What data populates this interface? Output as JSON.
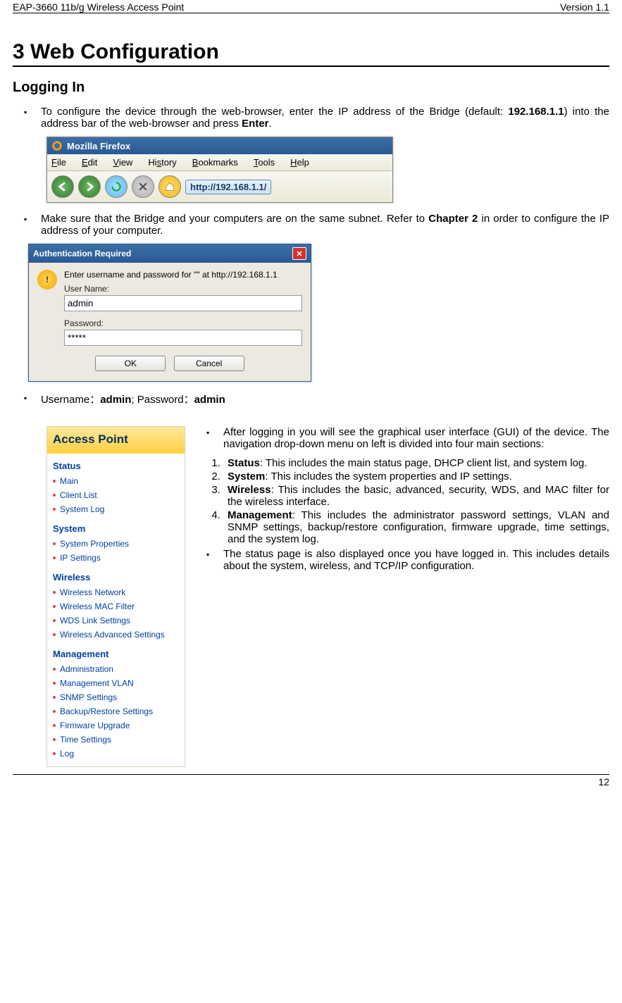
{
  "header": {
    "left": "EAP-3660  11b/g Wireless Access Point",
    "right": "Version 1.1"
  },
  "chapter": "3  Web Configuration",
  "section": "Logging In",
  "bullet1": {
    "pre": "To configure the device through the web-browser, enter the IP address of the Bridge (default: ",
    "ip": "192.168.1.1",
    "post1": ") into the address bar of the web-browser and press ",
    "enter": "Enter",
    "post2": "."
  },
  "firefox": {
    "title": "Mozilla Firefox",
    "menu": {
      "file": "File",
      "edit": "Edit",
      "view": "View",
      "history": "History",
      "bookmarks": "Bookmarks",
      "tools": "Tools",
      "help": "Help"
    },
    "url": "http://192.168.1.1/"
  },
  "bullet2": {
    "pre": "Make sure that the Bridge and your computers are on the same subnet. Refer to ",
    "chap": "Chapter 2",
    "post": " in order to configure the IP address of your computer."
  },
  "auth": {
    "title": "Authentication Required",
    "prompt": "Enter username and password for \"\" at http://192.168.1.1",
    "user_label": "User Name:",
    "user_value": "admin",
    "pass_label": "Password:",
    "pass_value": "*****",
    "ok": "OK",
    "cancel": "Cancel"
  },
  "bullet3": {
    "pre": "Username：",
    "u": "admin",
    "mid": "; Password：",
    "p": "admin"
  },
  "sidebar": {
    "banner": "Access Point",
    "status": {
      "title": "Status",
      "items": [
        "Main",
        "Client List",
        "System Log"
      ]
    },
    "system": {
      "title": "System",
      "items": [
        "System Properties",
        "IP Settings"
      ]
    },
    "wireless": {
      "title": "Wireless",
      "items": [
        "Wireless Network",
        "Wireless MAC Filter",
        "WDS Link Settings",
        "Wireless Advanced Settings"
      ]
    },
    "management": {
      "title": "Management",
      "items": [
        "Administration",
        "Management VLAN",
        "SNMP Settings",
        "Backup/Restore Settings",
        "Firmware Upgrade",
        "Time Settings",
        "Log"
      ]
    }
  },
  "right": {
    "intro": "After logging in you will see the graphical user interface (GUI) of the device. The navigation drop-down menu on left is divided into four main sections:",
    "items": [
      {
        "b": "Status",
        "t": ": This includes the main status page, DHCP client list, and system log."
      },
      {
        "b": "System",
        "t": ": This includes the system properties and IP settings."
      },
      {
        "b": "Wireless",
        "t": ": This includes the basic, advanced, security, WDS, and MAC filter for the wireless interface."
      },
      {
        "b": "Management",
        "t": ": This includes the administrator password settings, VLAN and SNMP settings, backup/restore configuration, firmware upgrade, time settings, and the system log."
      }
    ],
    "outro": "The status page is also displayed once you have logged in. This includes details about the system, wireless, and TCP/IP configuration."
  },
  "footer": "12"
}
